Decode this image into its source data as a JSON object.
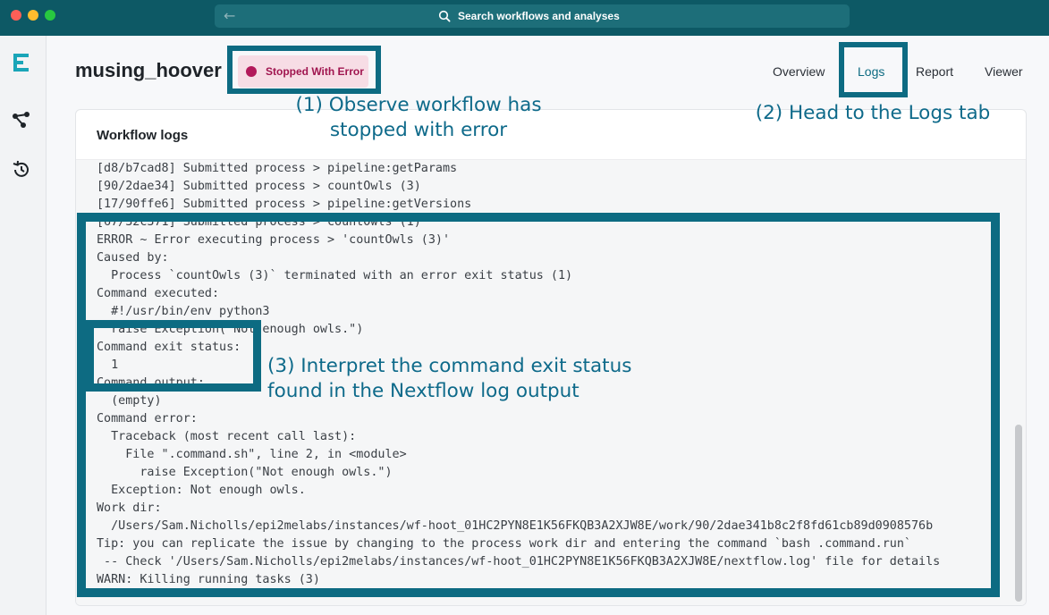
{
  "titlebar": {
    "search_placeholder": "Search workflows and analyses"
  },
  "workflow": {
    "name": "musing_hoover",
    "status": "Stopped With Error"
  },
  "tabs": [
    "Overview",
    "Logs",
    "Report",
    "Viewer"
  ],
  "active_tab": "Logs",
  "card": {
    "title": "Workflow logs"
  },
  "log_lines": [
    "[d8/b7cad8] Submitted process > pipeline:getParams",
    "[90/2dae34] Submitted process > countOwls (3)",
    "[17/90ffe6] Submitted process > pipeline:getVersions",
    "[67/32c371] Submitted process > countOwls (1)",
    "ERROR ~ Error executing process > 'countOwls (3)'",
    "Caused by:",
    "  Process `countOwls (3)` terminated with an error exit status (1)",
    "Command executed:",
    "  #!/usr/bin/env python3",
    "  raise Exception(\"Not enough owls.\")",
    "Command exit status:",
    "  1",
    "Command output:",
    "  (empty)",
    "Command error:",
    "  Traceback (most recent call last):",
    "    File \".command.sh\", line 2, in <module>",
    "      raise Exception(\"Not enough owls.\")",
    "  Exception: Not enough owls.",
    "Work dir:",
    "  /Users/Sam.Nicholls/epi2melabs/instances/wf-hoot_01HC2PYN8E1K56FKQB3A2XJW8E/work/90/2dae341b8c2f8fd61cb89d0908576b",
    "Tip: you can replicate the issue by changing to the process work dir and entering the command `bash .command.run`",
    " -- Check '/Users/Sam.Nicholls/epi2melabs/instances/wf-hoot_01HC2PYN8E1K56FKQB3A2XJW8E/nextflow.log' file for details",
    "WARN: Killing running tasks (3)"
  ],
  "annotations": {
    "step1_line1": "(1) Observe workflow has",
    "step1_line2": "stopped with error",
    "step2": "(2) Head to the Logs tab",
    "step3_line1": "(3) Interpret the command exit status",
    "step3_line2": "found in the Nextflow log output"
  },
  "colors": {
    "titlebar": "#0d5965",
    "annotation": "#0d6b82",
    "error_badge_bg": "#f7dde5",
    "error_badge_dot": "#b3195a"
  }
}
